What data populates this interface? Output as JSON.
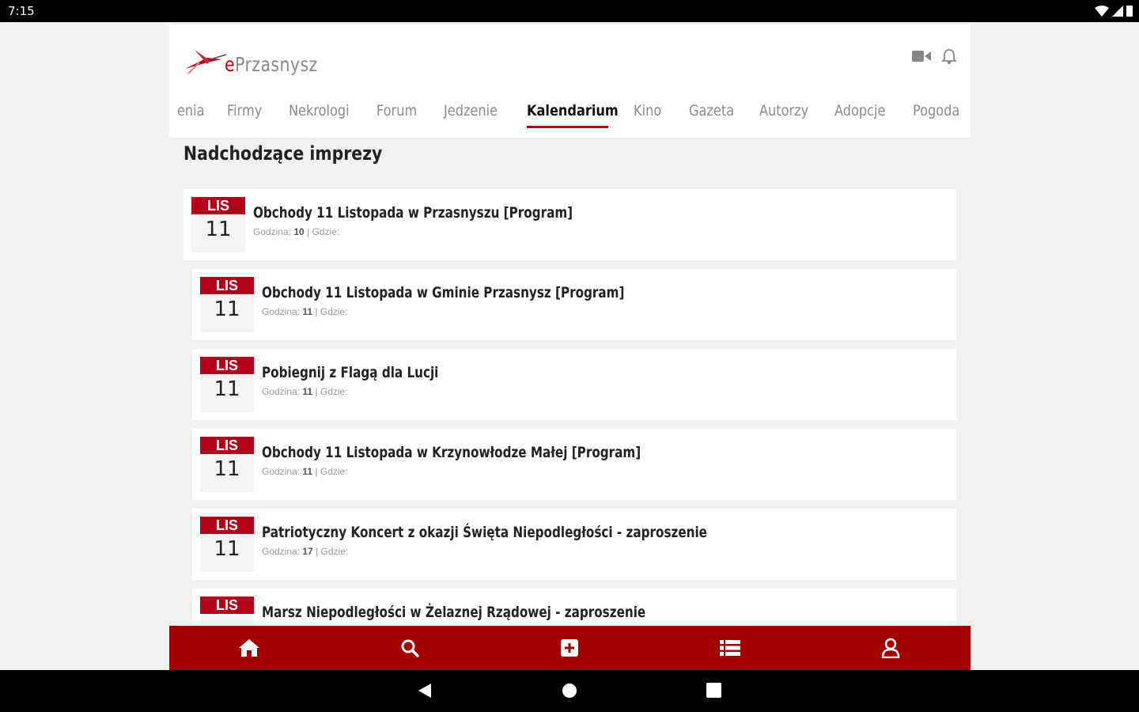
{
  "status_bar": {
    "time": "7:15"
  },
  "app": {
    "logo": {
      "prefix": "e",
      "name": "Przasnysz"
    },
    "header_icons": [
      "video-icon",
      "bell-icon"
    ],
    "tabs": [
      {
        "label": "enia",
        "active": false
      },
      {
        "label": "Firmy",
        "active": false
      },
      {
        "label": "Nekrologi",
        "active": false
      },
      {
        "label": "Forum",
        "active": false
      },
      {
        "label": "Jedzenie",
        "active": false
      },
      {
        "label": "Kalendarium",
        "active": true
      },
      {
        "label": "Kino",
        "active": false
      },
      {
        "label": "Gazeta",
        "active": false
      },
      {
        "label": "Autorzy",
        "active": false
      },
      {
        "label": "Adopcje",
        "active": false
      },
      {
        "label": "Pogoda",
        "active": false
      }
    ],
    "section_title": "Nadchodzące imprezy",
    "events": [
      {
        "month": "LIS",
        "day": "11",
        "title": "Obchody 11 Listopada w Przasnyszu [Program]",
        "meta_label": "Godzina:",
        "hour": "10",
        "place_label": "| Gdzie:"
      },
      {
        "month": "LIS",
        "day": "11",
        "title": "Obchody 11 Listopada w Gminie Przasnysz [Program]",
        "meta_label": "Godzina:",
        "hour": "11",
        "place_label": "| Gdzie:"
      },
      {
        "month": "LIS",
        "day": "11",
        "title": "Pobiegnij z Flagą dla Lucji",
        "meta_label": "Godzina:",
        "hour": "11",
        "place_label": "| Gdzie:"
      },
      {
        "month": "LIS",
        "day": "11",
        "title": "Obchody 11 Listopada w Krzynowłodze Małej [Program]",
        "meta_label": "Godzina:",
        "hour": "11",
        "place_label": "| Gdzie:"
      },
      {
        "month": "LIS",
        "day": "11",
        "title": "Patriotyczny Koncert z okazji Święta Niepodległości - zaproszenie",
        "meta_label": "Godzina:",
        "hour": "17",
        "place_label": "| Gdzie:"
      },
      {
        "month": "LIS",
        "day": "",
        "title": "Marsz Niepodległości w Żelaznej Rządowej - zaproszenie",
        "meta_label": "",
        "hour": "",
        "place_label": ""
      }
    ],
    "bottom_nav": [
      "home-icon",
      "search-icon",
      "add-icon",
      "list-icon",
      "user-icon"
    ],
    "colors": {
      "accent": "#a30000",
      "badge": "#b3001b"
    }
  }
}
